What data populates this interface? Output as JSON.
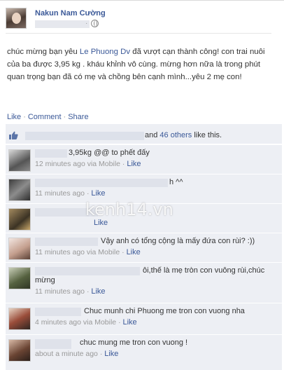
{
  "post": {
    "author": "Nakun Nam Cường",
    "meta_dot": "·",
    "text_prefix": "chúc mừng bạn yêu ",
    "mention": "Le Phuong Dv",
    "text_suffix": " đã vượt cạn thành công! con trai nuôi của ba được 3,95 kg . kháu khỉnh vô cùng. mừng hơn nữa là trong phút quan trọng bạn đã có mẹ và chồng bên cạnh mình...yêu 2 mẹ con!"
  },
  "actions": {
    "like": "Like",
    "comment": "Comment",
    "share": "Share",
    "sep": "·"
  },
  "likes": {
    "and": "and ",
    "others": "46 others",
    "suffix": " like this."
  },
  "comments": [
    {
      "text": "3,95kg @@ to phết đấy",
      "time": "12 minutes ago via Mobile",
      "like": "Like",
      "avatar": "#6f6f6f"
    },
    {
      "text": "h ^^",
      "time": "11 minutes ago",
      "like": "Like",
      "avatar": "#5a5a5a"
    },
    {
      "text": "",
      "time": "",
      "like": "Like",
      "avatar": "#7c6a4f"
    },
    {
      "text": "Vậy anh có tổng cộng là mấy đứa con rùi? :))",
      "time": "11 minutes ago via Mobile",
      "like": "Like",
      "avatar": "#c9a497"
    },
    {
      "text": "ôi,thế là mẹ tròn con vuông rùi,chúc",
      "text2": "mừng",
      "time": "11 minutes ago",
      "like": "Like",
      "avatar": "#6b7359"
    },
    {
      "text": "Chuc munh chi Phuong me tron con vuong nha",
      "time": "4 minutes ago via Mobile",
      "like": "Like",
      "avatar": "#8a5b4a"
    },
    {
      "text": "chuc mung me tron con vuong !",
      "time": "about a minute ago",
      "like": "Like",
      "avatar": "#6a4e3e"
    }
  ],
  "watermark": "kenh14.vn",
  "colors": {
    "link": "#3b5998",
    "feedback_bg": "#edeff4",
    "meta": "#999999"
  }
}
